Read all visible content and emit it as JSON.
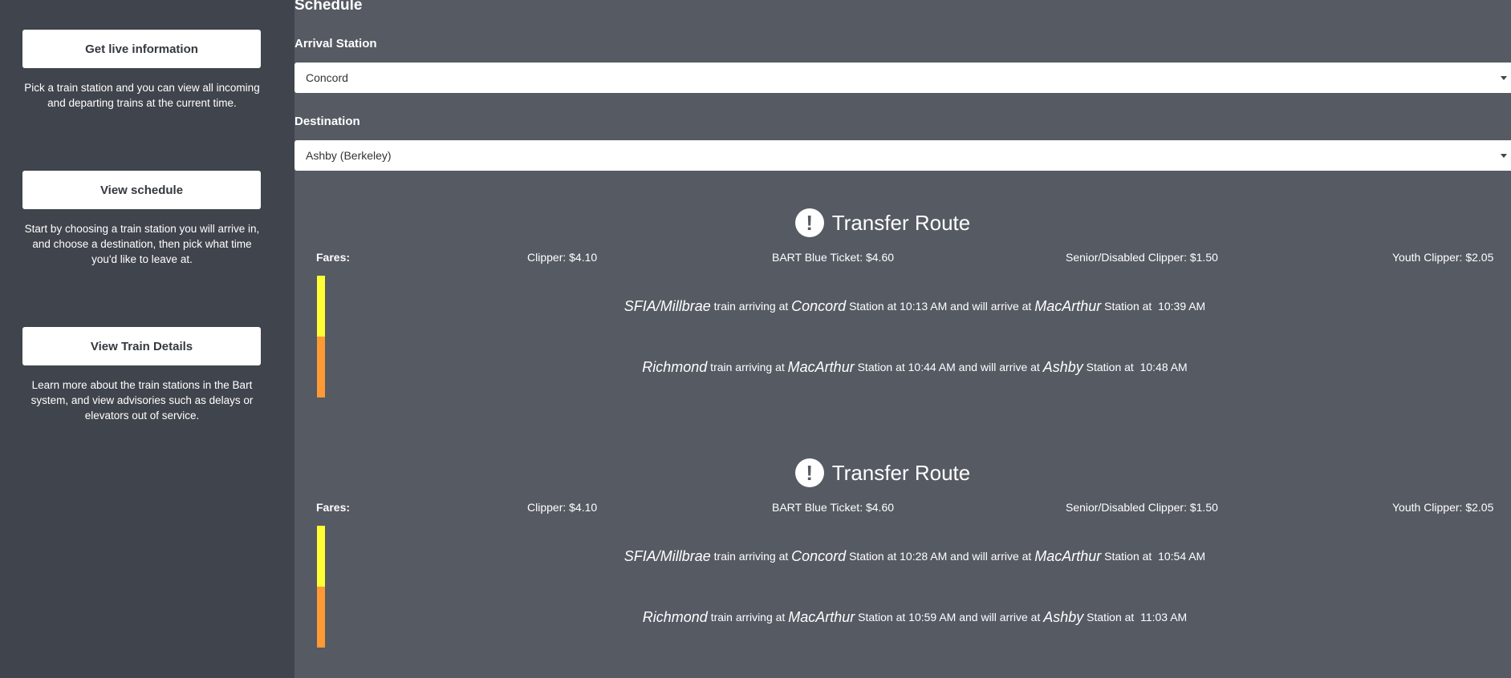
{
  "sidebar": {
    "items": [
      {
        "button": "Get live information",
        "description": "Pick a train station and you can view all incoming and departing trains at the current time."
      },
      {
        "button": "View schedule",
        "description": "Start by choosing a train station you will arrive in, and choose a destination, then pick what time you'd like to leave at."
      },
      {
        "button": "View Train Details",
        "description": "Learn more about the train stations in the Bart system, and view advisories such as delays or elevators out of service."
      }
    ]
  },
  "main": {
    "title": "Schedule",
    "arrival_label": "Arrival Station",
    "arrival_value": "Concord",
    "destination_label": "Destination",
    "destination_value": "Ashby (Berkeley)"
  },
  "routes": [
    {
      "title": "Transfer Route",
      "icon": "exclamation-icon",
      "fares": {
        "label": "Fares:",
        "clipper": "Clipper: $4.10",
        "bart_blue": "BART Blue Ticket: $4.60",
        "senior": "Senior/Disabled Clipper: $1.50",
        "youth": "Youth Clipper: $2.05"
      },
      "legs": [
        {
          "color": "#ffff33",
          "train": "SFIA/Millbrae",
          "t1": " train arriving at ",
          "from": "Concord",
          "t2": " Station at 10:13 AM and will arrive at ",
          "to": "MacArthur",
          "t3": " Station at  10:39 AM"
        },
        {
          "color": "#ff9933",
          "train": "Richmond",
          "t1": " train arriving at ",
          "from": "MacArthur",
          "t2": " Station at 10:44 AM and will arrive at ",
          "to": "Ashby",
          "t3": " Station at  10:48 AM"
        }
      ]
    },
    {
      "title": "Transfer Route",
      "icon": "exclamation-icon",
      "fares": {
        "label": "Fares:",
        "clipper": "Clipper: $4.10",
        "bart_blue": "BART Blue Ticket: $4.60",
        "senior": "Senior/Disabled Clipper: $1.50",
        "youth": "Youth Clipper: $2.05"
      },
      "legs": [
        {
          "color": "#ffff33",
          "train": "SFIA/Millbrae",
          "t1": " train arriving at ",
          "from": "Concord",
          "t2": " Station at 10:28 AM and will arrive at ",
          "to": "MacArthur",
          "t3": " Station at  10:54 AM"
        },
        {
          "color": "#ff9933",
          "train": "Richmond",
          "t1": " train arriving at ",
          "from": "MacArthur",
          "t2": " Station at 10:59 AM and will arrive at ",
          "to": "Ashby",
          "t3": " Station at  11:03 AM"
        }
      ]
    }
  ]
}
